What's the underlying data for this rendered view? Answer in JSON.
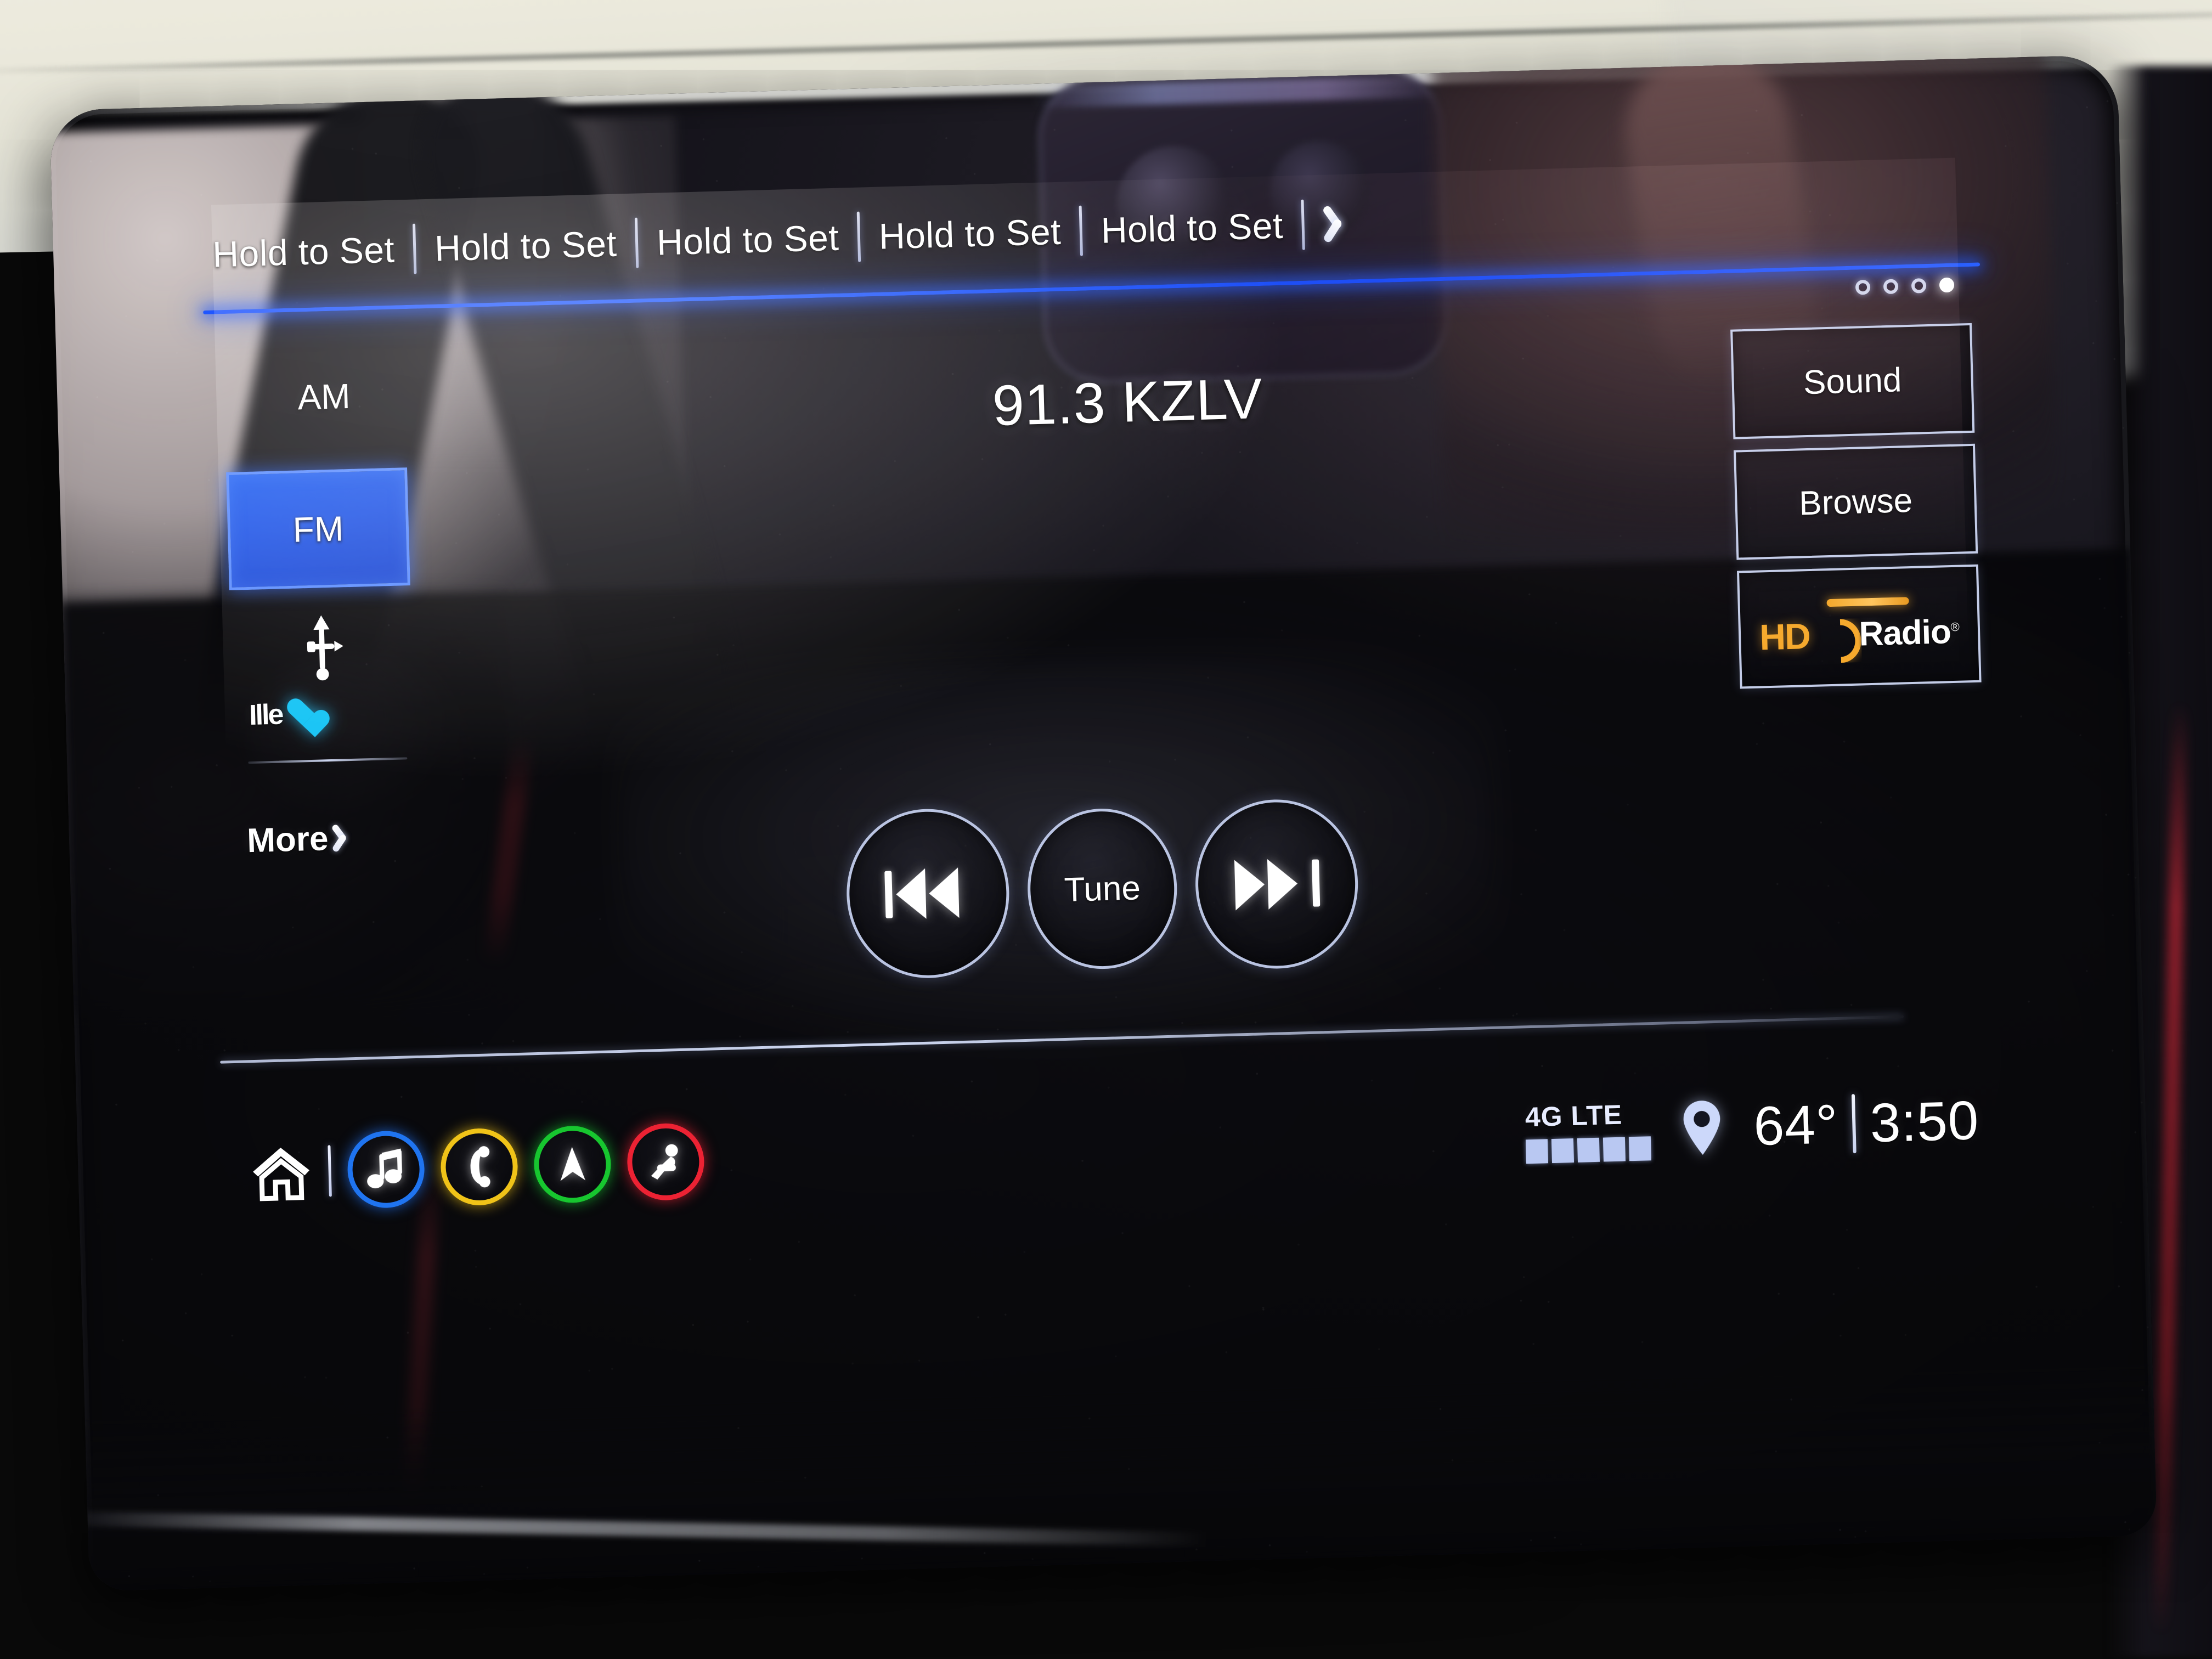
{
  "presets": {
    "items": [
      {
        "label": "Hold to Set"
      },
      {
        "label": "Hold to Set"
      },
      {
        "label": "Hold to Set"
      },
      {
        "label": "Hold to Set"
      },
      {
        "label": "Hold to Set"
      }
    ],
    "next_icon": "chevron-right-icon",
    "accent_color": "#2060ff",
    "page_dots": {
      "count": 4,
      "active_index": 3
    }
  },
  "sources": {
    "am_label": "AM",
    "fm_label": "FM",
    "fm_selected": true,
    "fm_highlight_color": "#2060f2",
    "usb_icon": "usb-icon",
    "bluetooth_label": "Ille",
    "bluetooth_icon": "bluetooth-heart-icon",
    "bluetooth_icon_color": "#17c4f5",
    "more_label": "More",
    "more_icon": "chevron-right-icon"
  },
  "now_playing": {
    "station": "91.3 KZLV"
  },
  "actions": {
    "sound_label": "Sound",
    "browse_label": "Browse",
    "hd_radio": {
      "mark": "HD",
      "word": "Radio",
      "registered": "®",
      "accent_color": "#f6a92c"
    }
  },
  "transport": {
    "previous_icon": "skip-previous-icon",
    "tune_label": "Tune",
    "next_icon": "skip-next-icon"
  },
  "taskbar": {
    "home_icon": "home-icon",
    "items": [
      {
        "icon": "music-note-icon",
        "name": "audio",
        "color": "#1f74f0"
      },
      {
        "icon": "phone-handset-icon",
        "name": "phone",
        "color": "#f0c318"
      },
      {
        "icon": "navigation-arrow-icon",
        "name": "navigation",
        "color": "#17c62f"
      },
      {
        "icon": "seat-comfort-icon",
        "name": "climate-seat",
        "color": "#ec2233"
      }
    ]
  },
  "status": {
    "network_label": "4G LTE",
    "signal_bars": 5,
    "signal_bars_total": 5,
    "location_icon": "location-pin-icon",
    "temperature": "64°",
    "time": "3:50"
  }
}
